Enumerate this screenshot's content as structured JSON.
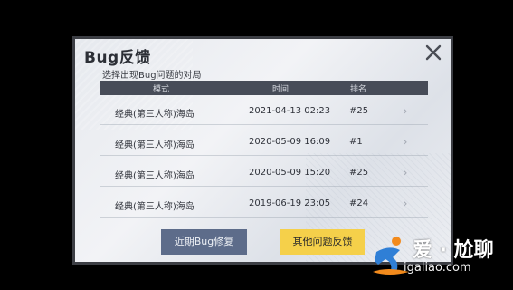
{
  "dialog": {
    "title": "Bug反馈",
    "subtitle": "选择出现Bug问题的对局"
  },
  "table": {
    "headers": [
      "模式",
      "时间",
      "排名"
    ],
    "rows": [
      {
        "mode": "经典(第三人称)海岛",
        "time": "2021-04-13 02:23",
        "rank": "#25"
      },
      {
        "mode": "经典(第三人称)海岛",
        "time": "2020-05-09 16:09",
        "rank": "#1"
      },
      {
        "mode": "经典(第三人称)海岛",
        "time": "2020-05-09 15:20",
        "rank": "#25"
      },
      {
        "mode": "经典(第三人称)海岛",
        "time": "2019-06-19 23:05",
        "rank": "#24"
      }
    ]
  },
  "buttons": {
    "recent_fix": "近期Bug修复",
    "other_feedback": "其他问题反馈"
  },
  "watermark": {
    "brand": "爱 · 尬聊",
    "url": "igaliao.com"
  },
  "icons": {
    "close": "close-icon",
    "row_chevron": "chevron-right-icon",
    "watermark_logo": "runner-logo-icon"
  },
  "colors": {
    "header_bg": "#474c58",
    "left_button": "#5d6c8a",
    "right_button": "#f5d04a"
  }
}
